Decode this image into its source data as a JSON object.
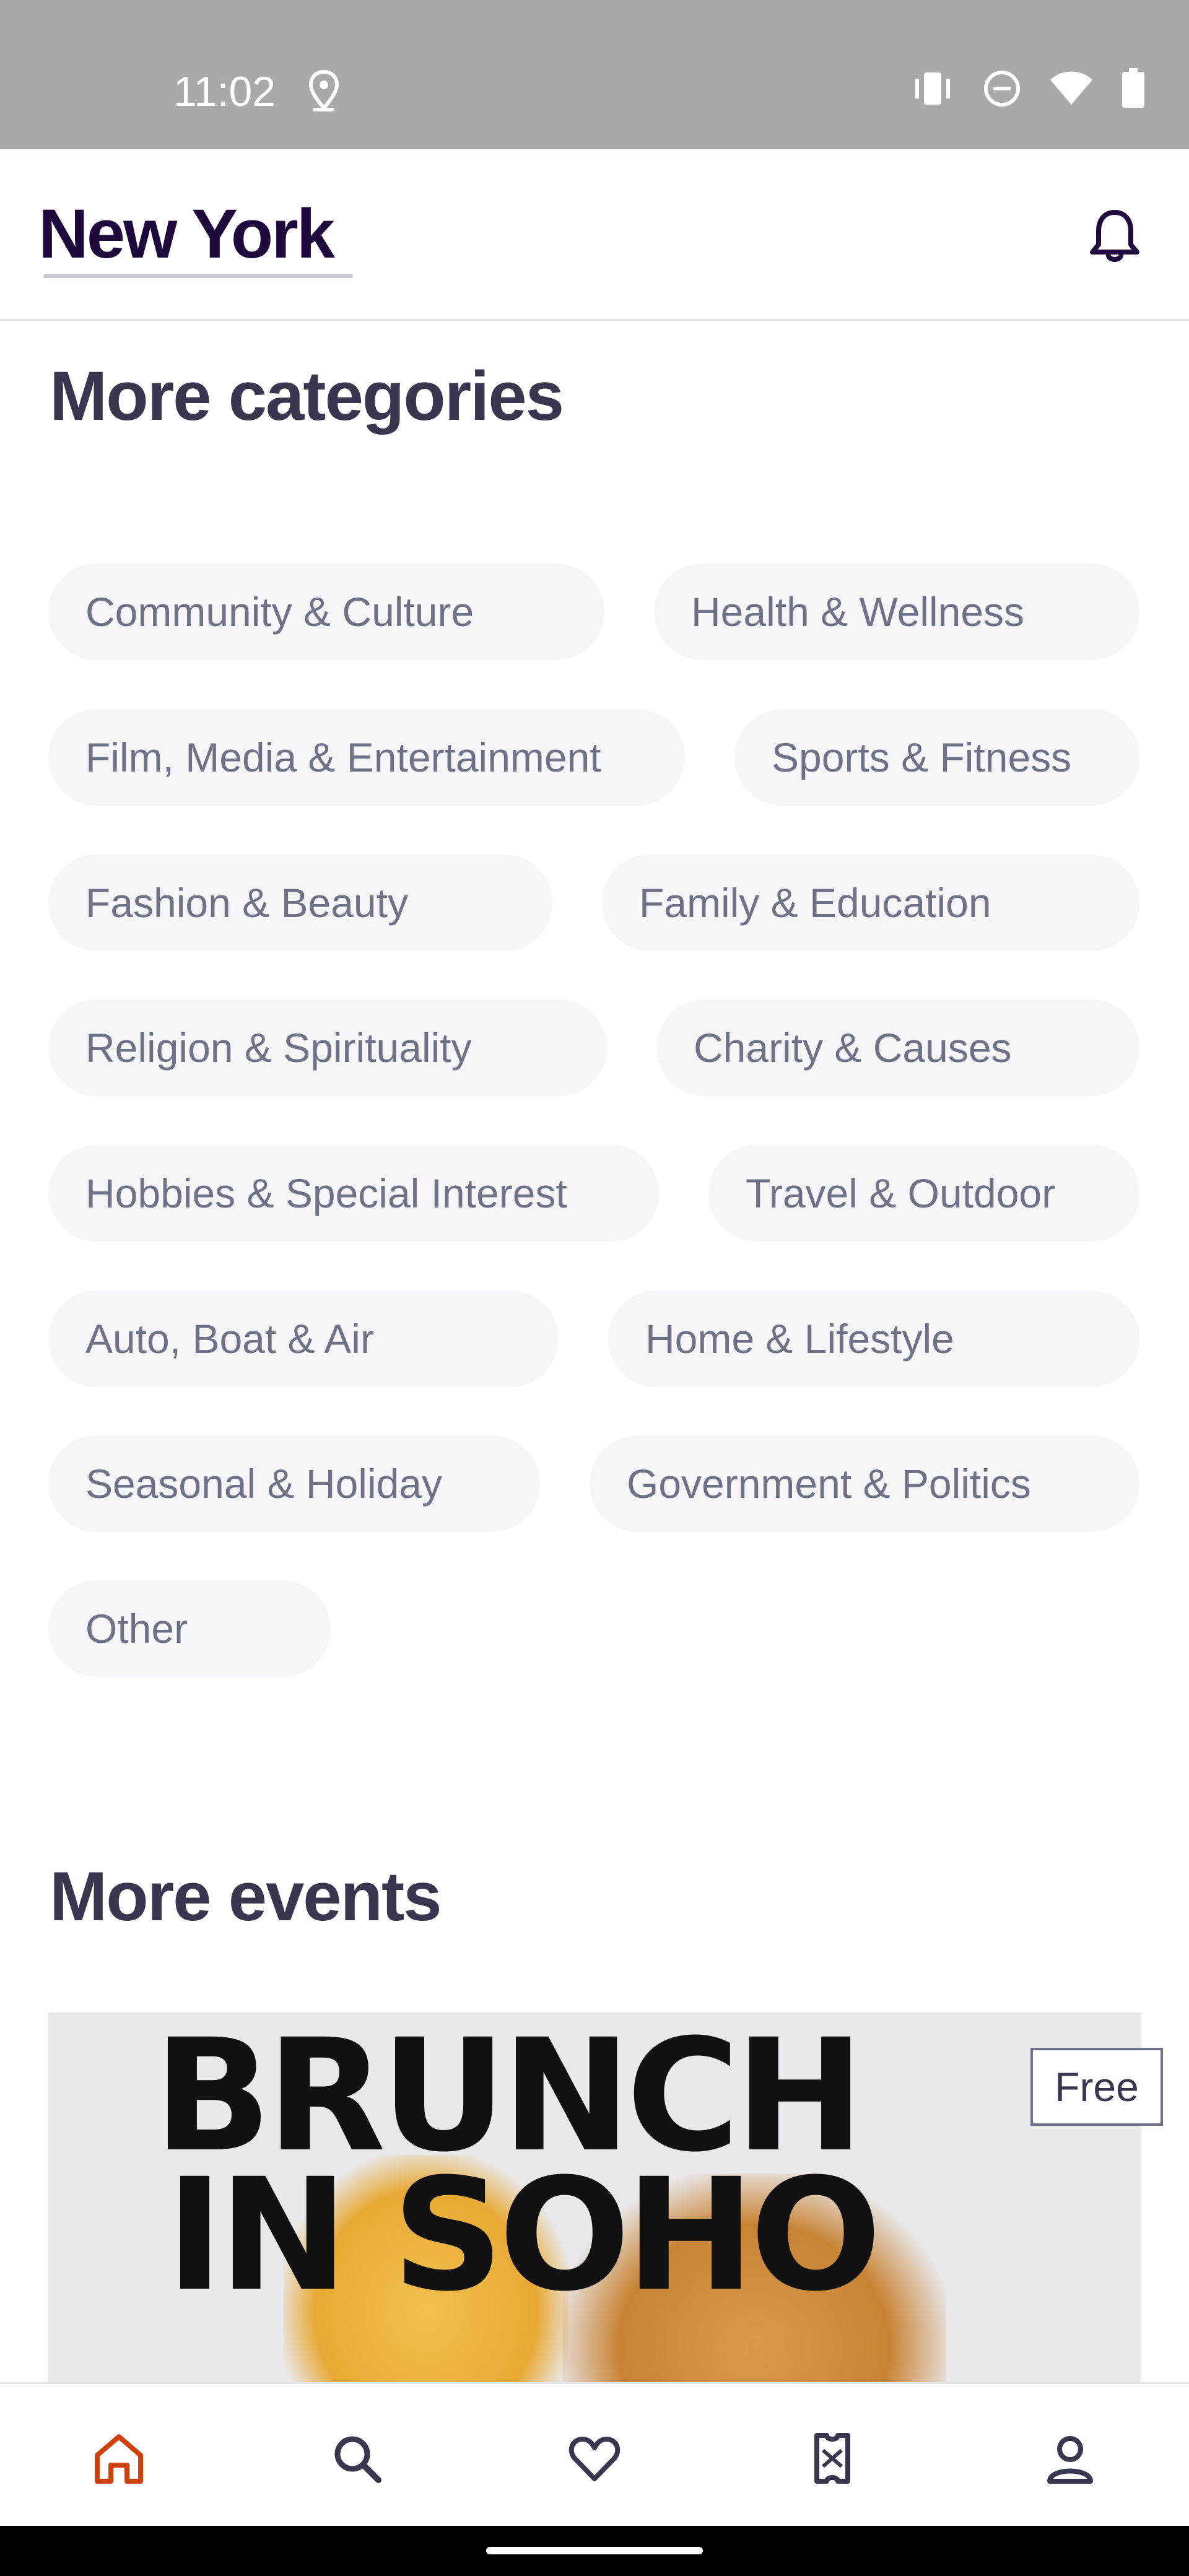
{
  "status_bar": {
    "time": "11:02",
    "icons": [
      "location-icon",
      "vibrate-icon",
      "do-not-disturb-icon",
      "wifi-icon",
      "battery-icon"
    ]
  },
  "header": {
    "city": "New York",
    "notification_icon": "bell-icon"
  },
  "categories_section": {
    "title": "More categories",
    "chips": [
      "Community & Culture",
      "Health & Wellness",
      "Film, Media & Entertainment",
      "Sports & Fitness",
      "Fashion & Beauty",
      "Family & Education",
      "Religion & Spirituality",
      "Charity & Causes",
      "Hobbies & Special Interest",
      "Travel & Outdoor",
      "Auto, Boat & Air",
      "Home & Lifestyle",
      "Seasonal & Holiday",
      "Government & Politics",
      "Other"
    ]
  },
  "events_section": {
    "title": "More events",
    "event": {
      "poster_line_1": "BRUNCH",
      "poster_line_2": "IN SOHO",
      "price_badge": "Free"
    }
  },
  "bottom_nav": {
    "items": [
      "home-icon",
      "search-icon",
      "heart-icon",
      "ticket-icon",
      "profile-icon"
    ],
    "active": "home-icon",
    "active_color": "#d1410c",
    "inactive_color": "#39364f"
  }
}
